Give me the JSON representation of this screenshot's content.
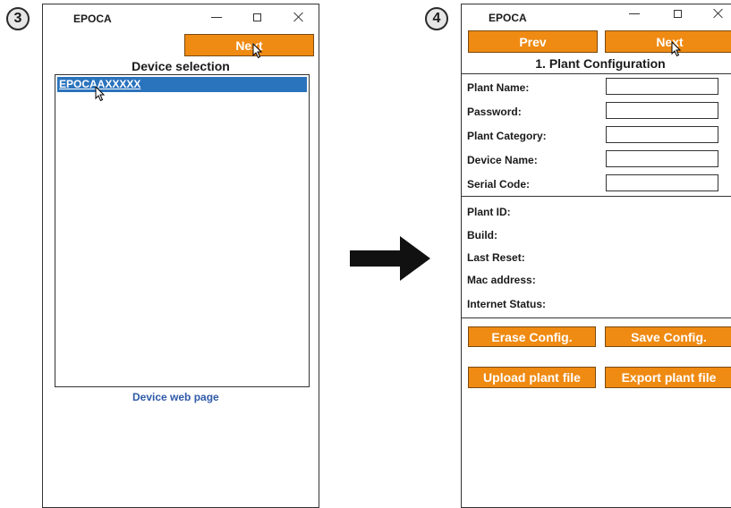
{
  "step3": {
    "badge": "3",
    "window_title": "EPOCA",
    "next_button": "Next",
    "heading": "Device selection",
    "list_items": [
      "EPOCAAXXXXX"
    ],
    "web_link": "Device web page"
  },
  "step4": {
    "badge": "4",
    "window_title": "EPOCA",
    "prev_button": "Prev",
    "next_button": "Next",
    "heading": "1. Plant Configuration",
    "fields": [
      {
        "label": "Plant Name:",
        "value": ""
      },
      {
        "label": "Password:",
        "value": ""
      },
      {
        "label": "Plant Category:",
        "value": ""
      },
      {
        "label": "Device Name:",
        "value": ""
      },
      {
        "label": "Serial Code:",
        "value": ""
      }
    ],
    "info": [
      "Plant ID:",
      "Build:",
      "Last Reset:",
      "Mac address:",
      "Internet Status:"
    ],
    "erase_button": "Erase Config.",
    "save_button": "Save Config.",
    "upload_button": "Upload plant file",
    "export_button": "Export plant file"
  },
  "colors": {
    "button": "#ef8a12",
    "selection": "#2a73bd",
    "link": "#2f5aa8"
  },
  "icons": [
    "minimize-icon",
    "maximize-icon",
    "close-icon",
    "cursor-icon",
    "arrow-right-icon"
  ]
}
